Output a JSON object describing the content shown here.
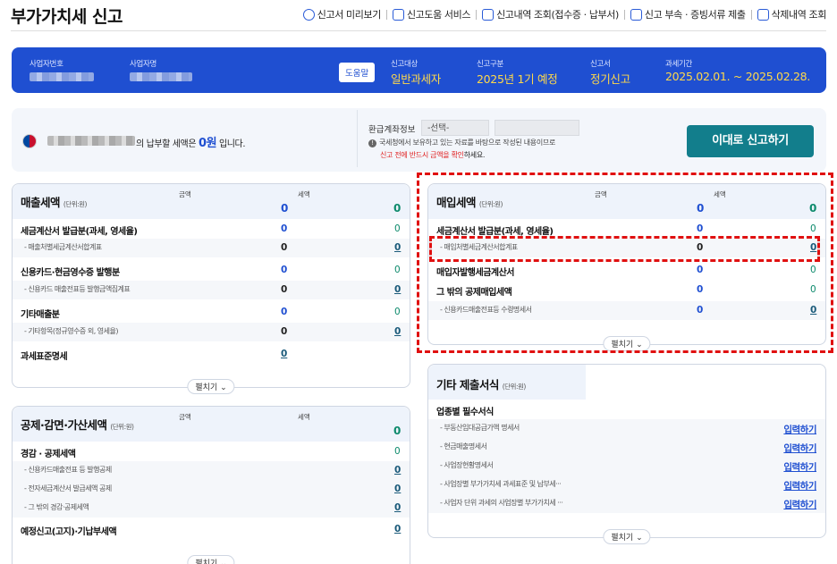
{
  "page_title": "부가가치세 신고",
  "topnav": [
    {
      "label": "신고서 미리보기",
      "icon": "search-icon"
    },
    {
      "label": "신고도움 서비스",
      "icon": "monitor-icon"
    },
    {
      "label": "신고내역 조회(접수증 · 납부서)",
      "icon": "document-icon"
    },
    {
      "label": "신고 부속 · 증빙서류 제출",
      "icon": "upload-icon"
    },
    {
      "label": "삭제내역 조회",
      "icon": "trash-icon"
    }
  ],
  "banner": {
    "biz_no_label": "사업자번호",
    "biz_name_label": "사업자명",
    "help_label": "도움말",
    "target_label": "신고대상",
    "target_value": "일반과세자",
    "type_label": "신고구분",
    "type_value": "2025년 1기 예정",
    "form_label": "신고서",
    "form_value": "정기신고",
    "period_label": "과세기간",
    "period_value": "2025.02.01. ~ 2025.02.28."
  },
  "info": {
    "tax_text_pre": "의 납부할 세액은",
    "tax_amount": "0원",
    "tax_text_post": "입니다.",
    "refund_label": "환급계좌정보",
    "refund_select": "-선택-",
    "notice1": "국세청에서 보유하고 있는 자료를 바탕으로 작성된 내용이므로",
    "notice2_red": "신고 전에 반드시 금액을 확인",
    "notice2_tail": "하세요.",
    "submit": "이대로 신고하기"
  },
  "colhdr": {
    "amount": "금액",
    "tax": "세액",
    "unit": "(단위:원)",
    "expand": "펼치기"
  },
  "sales": {
    "title": "매출세액",
    "total_amount": "0",
    "total_tax": "0",
    "rows": [
      {
        "name": "세금계산서 발급분(과세, 영세율)",
        "amount": "0",
        "tax": "0"
      },
      {
        "name": "- 매출처별세금계산서합계표",
        "amount": "0",
        "tax": "0"
      },
      {
        "name": "신용카드·현금영수증 발행분",
        "amount": "0",
        "tax": "0"
      },
      {
        "name": "- 신용카드 매출전표등 발행금액집계표",
        "amount": "0",
        "tax": "0"
      },
      {
        "name": "기타매출분",
        "amount": "0",
        "tax": "0"
      },
      {
        "name": "- 기타항목(정규영수증 외, 영세율)",
        "amount": "0",
        "tax": "0"
      },
      {
        "name": "과세표준명세",
        "amount": "0"
      }
    ]
  },
  "deduct": {
    "title": "공제·감면·가산세액",
    "total_tax": "0",
    "rows": [
      {
        "name": "경감 · 공제세액",
        "tax": "0"
      },
      {
        "name": "- 신용카드매출전표 등 발행공제",
        "tax": "0"
      },
      {
        "name": "- 전자세금계산서 발급세액 공제",
        "tax": "0"
      },
      {
        "name": "- 그 밖의 경감·공제세액",
        "tax": "0"
      },
      {
        "name": "예정신고(고지)·기납부세액",
        "tax": "0"
      }
    ]
  },
  "purchase": {
    "title": "매입세액",
    "total_amount": "0",
    "total_tax": "0",
    "rows": [
      {
        "name": "세금계산서 발급분(과세, 영세율)",
        "amount": "0",
        "tax": "0"
      },
      {
        "name": "- 매입처별세금계산서합계표",
        "amount": "0",
        "tax": "0"
      },
      {
        "name": "매입자발행세금계산서",
        "amount": "0",
        "tax": "0"
      },
      {
        "name": "그 밖의 공제매입세액",
        "amount": "0",
        "tax": "0"
      },
      {
        "name": "- 신용카드매출전표등 수령명세서",
        "amount": "0",
        "tax": "0"
      }
    ]
  },
  "other": {
    "title": "기타 제출서식",
    "section": "업종별 필수서식",
    "link_label": "입력하기",
    "rows": [
      {
        "name": "- 부동산임대공급가액 명세서"
      },
      {
        "name": "- 현금매출명세서"
      },
      {
        "name": "- 사업장현황명세서"
      },
      {
        "name": "- 사업장별 부가가치세 과세표준 및 납부세···"
      },
      {
        "name": "- 사업자 단위 과세의 사업장별 부가가치세 ···"
      }
    ]
  }
}
